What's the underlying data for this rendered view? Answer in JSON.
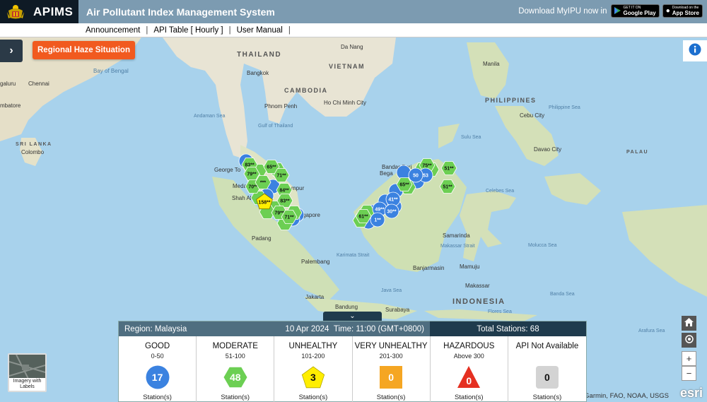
{
  "header": {
    "brand": "APIMS",
    "title": "Air Pollutant Index Management System",
    "download_text": "Download MyIPU now in",
    "google_play": {
      "small": "GET IT ON",
      "big": "Google Play"
    },
    "app_store": {
      "small": "Download on the",
      "big": "App Store"
    }
  },
  "nav": {
    "items": [
      "Announcement",
      "API Table [ Hourly ]",
      "User Manual"
    ]
  },
  "controls": {
    "side_toggle": "›",
    "haze_button": "Regional Haze Situation",
    "basemap_label": "Imagery with Labels",
    "zoom_in": "+",
    "zoom_out": "−",
    "attribution": "Garmin, FAO, NOAA, USGS",
    "esri": "esri"
  },
  "map_labels": {
    "thailand": "THAILAND",
    "vietnam": "VIETNAM",
    "cambodia": "CAMBODIA",
    "philippines": "PHILIPPINES",
    "indonesia": "INDONESIA",
    "palau": "PALAU",
    "sri_lanka": "SRI LANKA",
    "colombo": "Colombo",
    "chennai": "Chennai",
    "galuru": "galuru",
    "mbatore": "mbatore",
    "bay_of_bengal": "Bay of Bengal",
    "andaman_sea": "Andaman Sea",
    "gulf_of_thailand": "Gulf of Thailand",
    "sulu_sea": "Sulu Sea",
    "celebes_sea": "Celebes Sea",
    "philippine_sea": "Philippine Sea",
    "java_sea": "Java Sea",
    "karimata_strait": "Karimata Strait",
    "makassar_strait": "Makassar Strait",
    "flores_sea": "Flores Sea",
    "banda_sea": "Banda Sea",
    "arafura_sea": "Arafura Sea",
    "molucca_sea": "Molucca Sea",
    "bangkok": "Bangkok",
    "da_nang": "Da Nang",
    "phnom_penh": "Phnom Penh",
    "ho_chi_minh": "Ho Chi Minh City",
    "manila": "Manila",
    "cebu": "Cebu City",
    "davao": "Davao City",
    "george_town": "George To",
    "medan": "Meda",
    "shah_alam": "Shah Ala",
    "kuala_lumpur": "mpur",
    "singapore": "gapore",
    "padang": "Padang",
    "palembang": "Palembang",
    "jakarta": "Jakarta",
    "bandung": "Bandung",
    "surabaya": "Surabaya",
    "banjarmasin": "Banjarmasin",
    "samarinda": "Samarinda",
    "mamuju": "Mamuju",
    "makassar": "Makassar",
    "bandar_seri": "Bandar Seri",
    "begawan": "Bega"
  },
  "stations": [
    {
      "label": "83**",
      "cat": "moderate"
    },
    {
      "label": "65**",
      "cat": "moderate"
    },
    {
      "label": "79**",
      "cat": "moderate"
    },
    {
      "label": "71**",
      "cat": "moderate"
    },
    {
      "label": "70**",
      "cat": "moderate"
    },
    {
      "label": "***",
      "cat": "moderate"
    },
    {
      "label": "84**",
      "cat": "moderate"
    },
    {
      "label": "158**",
      "cat": "unhealthy"
    },
    {
      "label": "83**",
      "cat": "moderate"
    },
    {
      "label": "79**",
      "cat": "moderate"
    },
    {
      "label": "71**",
      "cat": "moderate"
    },
    {
      "label": "75**",
      "cat": "moderate"
    },
    {
      "label": "51**",
      "cat": "moderate"
    },
    {
      "label": "65**",
      "cat": "moderate"
    },
    {
      "label": "51**",
      "cat": "moderate"
    },
    {
      "label": "53",
      "cat": "good"
    },
    {
      "label": "50",
      "cat": "good"
    },
    {
      "label": "41**",
      "cat": "good"
    },
    {
      "label": "49**",
      "cat": "good"
    },
    {
      "label": "30**",
      "cat": "good"
    },
    {
      "label": "61**",
      "cat": "moderate"
    },
    {
      "label": "1**",
      "cat": "good"
    }
  ],
  "panel": {
    "region": "Region: Malaysia",
    "date": "10 Apr 2024",
    "time": "Time: 11:00 (GMT+0800)",
    "total": "Total Stations: 68",
    "categories": [
      {
        "name": "GOOD",
        "range": "0-50",
        "count": "17",
        "unit": "Station(s)",
        "shape": "circle",
        "color": "#3b82e0"
      },
      {
        "name": "MODERATE",
        "range": "51-100",
        "count": "48",
        "unit": "Station(s)",
        "shape": "hexagon",
        "color": "#6ccf53"
      },
      {
        "name": "UNHEALTHY",
        "range": "101-200",
        "count": "3",
        "unit": "Station(s)",
        "shape": "pentagon",
        "color": "#ffee00"
      },
      {
        "name": "VERY UNHEALTHY",
        "range": "201-300",
        "count": "0",
        "unit": "Station(s)",
        "shape": "square",
        "color": "#f5a623"
      },
      {
        "name": "HAZARDOUS",
        "range": "Above 300",
        "count": "0",
        "unit": "Station(s)",
        "shape": "triangle",
        "color": "#e53021"
      },
      {
        "name": "API Not Available",
        "range": "",
        "count": "0",
        "unit": "Station(s)",
        "shape": "rounded-square",
        "color": "#d3d3d3"
      }
    ]
  }
}
